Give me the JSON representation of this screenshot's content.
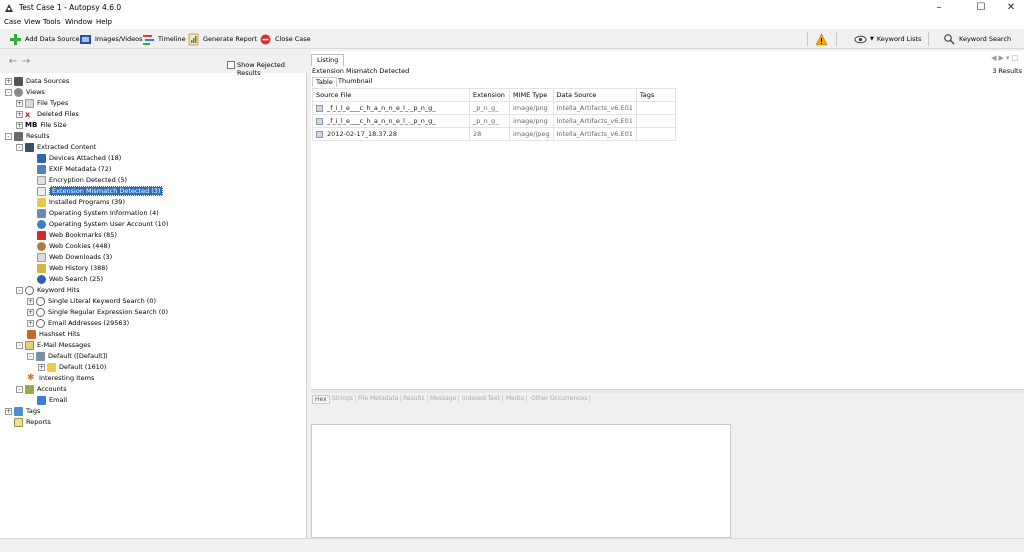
{
  "window": {
    "title": "Test Case 1 - Autopsy 4.6.0"
  },
  "menu": [
    "Case",
    "View",
    "Tools",
    "Window",
    "Help"
  ],
  "toolbar": {
    "add_data_source": "Add Data Source",
    "images_videos": "Images/Videos",
    "timeline": "Timeline",
    "generate_report": "Generate Report",
    "close_case": "Close Case",
    "keyword_lists": "Keyword Lists",
    "keyword_search": "Keyword Search"
  },
  "left": {
    "show_rejected": "Show Rejected Results"
  },
  "tree": {
    "data_sources": "Data Sources",
    "views": "Views",
    "file_types": "File Types",
    "deleted_files": "Deleted Files",
    "file_size_prefix": "MB",
    "file_size": "File Size",
    "results": "Results",
    "extracted_content": "Extracted Content",
    "extracted_items": [
      "Devices Attached (18)",
      "EXIF Metadata (72)",
      "Encryption Detected (5)",
      "Extension Mismatch Detected (3)",
      "Installed Programs (39)",
      "Operating System Information (4)",
      "Operating System User Account (10)",
      "Web Bookmarks (85)",
      "Web Cookies (448)",
      "Web Downloads (3)",
      "Web History (388)",
      "Web Search (25)"
    ],
    "keyword_hits": "Keyword Hits",
    "keyword_items": [
      "Single Literal Keyword Search (0)",
      "Single Regular Expression Search (0)",
      "Email Addresses (29563)"
    ],
    "hashset_hits": "Hashset Hits",
    "email_messages": "E-Mail Messages",
    "default_parent": "Default ([Default])",
    "default_child": "Default (1610)",
    "interesting_items": "Interesting Items",
    "accounts": "Accounts",
    "email": "Email",
    "tags": "Tags",
    "reports": "Reports"
  },
  "listing": {
    "tab": "Listing",
    "title": "Extension Mismatch Detected",
    "count": "3 Results",
    "subtabs": [
      "Table",
      "Thumbnail"
    ],
    "columns": [
      "Source File",
      "Extension",
      "MIME Type",
      "Data Source",
      "Tags"
    ],
    "rows": [
      [
        "_f_i_l_e___c_h_a_n_n_e_l_._p_n_g_",
        "_p_n_g_",
        "image/png",
        "Intella_Artifacts_v6.E01",
        ""
      ],
      [
        "_f_i_l_e___c_h_a_n_n_e_l_._p_n_g_",
        "_p_n_g_",
        "image/png",
        "Intella_Artifacts_v6.E01",
        ""
      ],
      [
        "2012-02-17_18.37.28",
        "28",
        "image/jpeg",
        "Intella_Artifacts_v6.E01",
        ""
      ]
    ]
  },
  "bottom_tabs": [
    "Hex",
    "Strings",
    "File Metadata",
    "Results",
    "Message",
    "Indexed Text",
    "Media",
    "Other Occurrences"
  ],
  "colors": {
    "selection": "#2a6ebf",
    "warning": "#f2a81d"
  }
}
